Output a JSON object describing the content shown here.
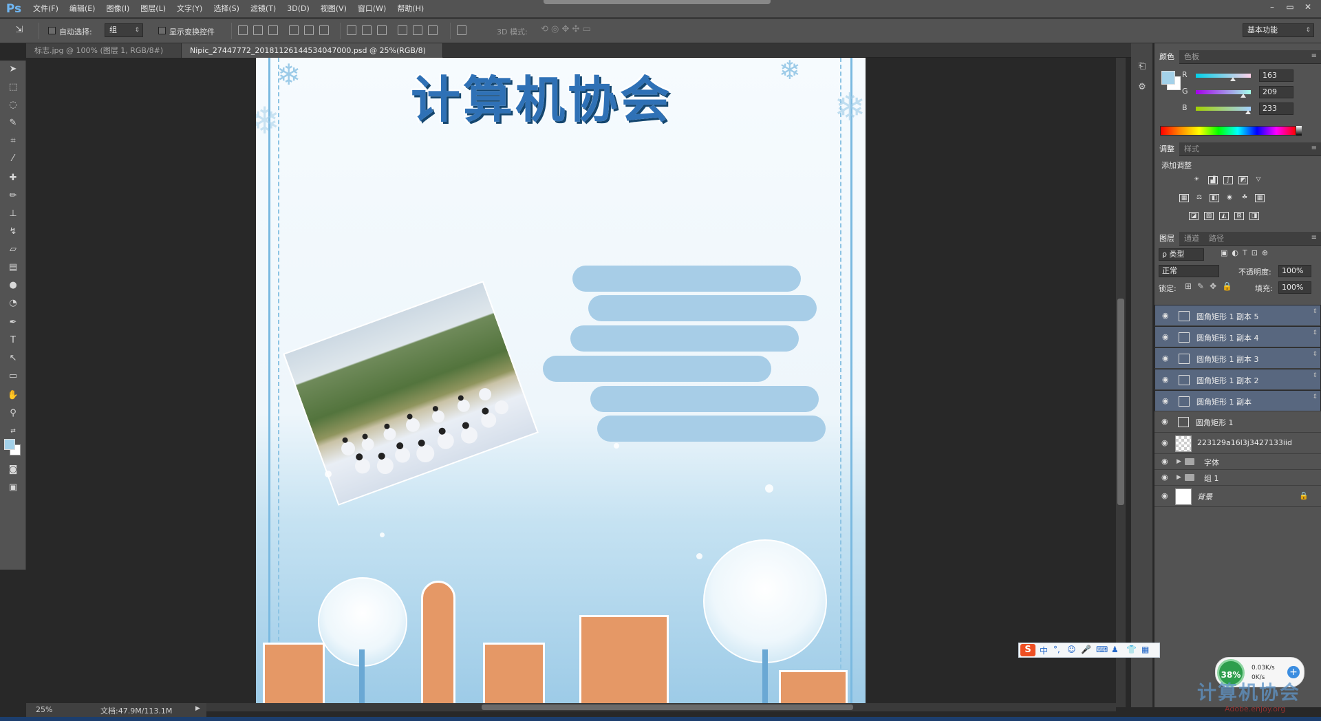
{
  "app": {
    "logo": "Ps",
    "menu": [
      "文件(F)",
      "编辑(E)",
      "图像(I)",
      "图层(L)",
      "文字(Y)",
      "选择(S)",
      "滤镜(T)",
      "3D(D)",
      "视图(V)",
      "窗口(W)",
      "帮助(H)"
    ],
    "window_buttons": [
      "–",
      "▭",
      "✕"
    ]
  },
  "options": {
    "auto_select_label": "自动选择:",
    "auto_select_value": "组",
    "transform_controls_label": "显示变换控件",
    "mode_3d_label": "3D 模式:",
    "workspace": "基本功能"
  },
  "tabs": [
    {
      "label": "标志.jpg @ 100% (图层 1, RGB/8#) *",
      "close": "×"
    },
    {
      "label": "Nipic_27447772_20181126144534047000.psd @ 25%(RGB/8) *",
      "close": "×"
    }
  ],
  "canvas": {
    "title": "计算机协会"
  },
  "status": {
    "zoom": "25%",
    "doc": "文档:47.9M/113.1M"
  },
  "color_panel": {
    "tabs": [
      "颜色",
      "色板"
    ],
    "r_label": "R",
    "r": "163",
    "g_label": "G",
    "g": "209",
    "b_label": "B",
    "b": "233",
    "foreground": "#a3d1e9",
    "background": "#ffffff"
  },
  "adjust_panel": {
    "tabs": [
      "调整",
      "样式"
    ],
    "title": "添加调整"
  },
  "layers_panel": {
    "tabs": [
      "图层",
      "通道",
      "路径"
    ],
    "filter": "ρ 类型",
    "blend": "正常",
    "opacity_label": "不透明度:",
    "opacity": "100%",
    "lock_label": "锁定:",
    "fill_label": "填充:",
    "fill": "100%",
    "layers": [
      {
        "name": "圆角矩形 1 副本 5",
        "selected": true
      },
      {
        "name": "圆角矩形 1 副本 4",
        "selected": true
      },
      {
        "name": "圆角矩形 1 副本 3",
        "selected": true
      },
      {
        "name": "圆角矩形 1 副本 2",
        "selected": true
      },
      {
        "name": "圆角矩形 1 副本",
        "selected": true
      },
      {
        "name": "圆角矩形 1",
        "selected": false
      }
    ],
    "image_layer": "223129a16l3j3427133iid",
    "group_text": "字体",
    "group_1": "组 1",
    "background_layer": "背景"
  },
  "ime": {
    "logo": "S",
    "items": [
      "中",
      "°,",
      "☺",
      "🎤",
      "⌨",
      "♟",
      "👕",
      "▦"
    ]
  },
  "net_widget": {
    "percent": "38%",
    "up": "0.03K/s",
    "down": "0K/s",
    "plus": "+"
  },
  "watermark": {
    "text": "计算机协会",
    "sub": "Adobe.enjoy.org"
  }
}
